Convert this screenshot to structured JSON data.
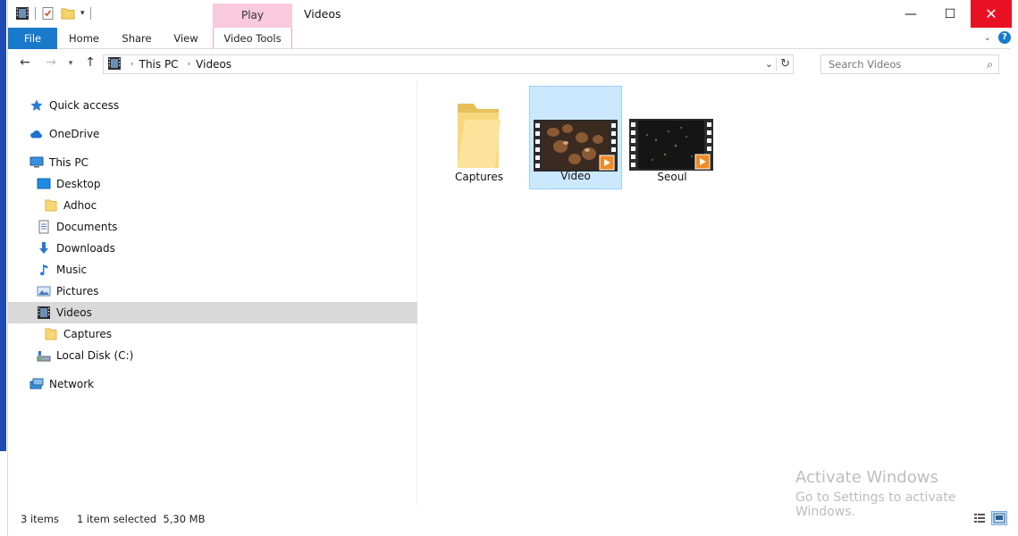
{
  "window": {
    "title": "Videos",
    "context_tab_label": "Play",
    "buttons": {
      "minimize": "—",
      "maximize": "☐",
      "close": "✕"
    }
  },
  "ribbon": {
    "tabs": [
      "File",
      "Home",
      "Share",
      "View",
      "Video Tools"
    ],
    "collapse_chevron": "⌄"
  },
  "address": {
    "crumbs": [
      "This PC",
      "Videos"
    ],
    "search_placeholder": "Search Videos"
  },
  "nav_pane": {
    "items": [
      {
        "label": "Quick access",
        "icon": "star-icon"
      },
      {
        "label": "OneDrive",
        "icon": "cloud-icon"
      },
      {
        "label": "This PC",
        "icon": "computer-icon"
      },
      {
        "label": "Desktop",
        "icon": "desktop-icon"
      },
      {
        "label": "Adhoc",
        "icon": "folder-icon"
      },
      {
        "label": "Documents",
        "icon": "documents-icon"
      },
      {
        "label": "Downloads",
        "icon": "download-icon"
      },
      {
        "label": "Music",
        "icon": "music-icon"
      },
      {
        "label": "Pictures",
        "icon": "pictures-icon"
      },
      {
        "label": "Videos",
        "icon": "videos-icon",
        "selected": true
      },
      {
        "label": "Captures",
        "icon": "folder-icon"
      },
      {
        "label": "Local Disk (C:)",
        "icon": "drive-icon"
      },
      {
        "label": "Network",
        "icon": "network-icon"
      }
    ]
  },
  "files": [
    {
      "name": "Captures",
      "type": "folder"
    },
    {
      "name": "Video",
      "type": "video",
      "selected": true
    },
    {
      "name": "Seoul",
      "type": "video"
    }
  ],
  "watermark": {
    "line1": "Activate Windows",
    "line2": "Go to Settings to activate Windows."
  },
  "status": {
    "item_count": "3 items",
    "selection": "1 item selected  5,30 MB"
  },
  "colors": {
    "file_tab": "#1979ca",
    "context_tab": "#f9c9dc",
    "close_button": "#e81123",
    "selection": "#cce8ff",
    "nav_selection": "#d9d9d9"
  }
}
